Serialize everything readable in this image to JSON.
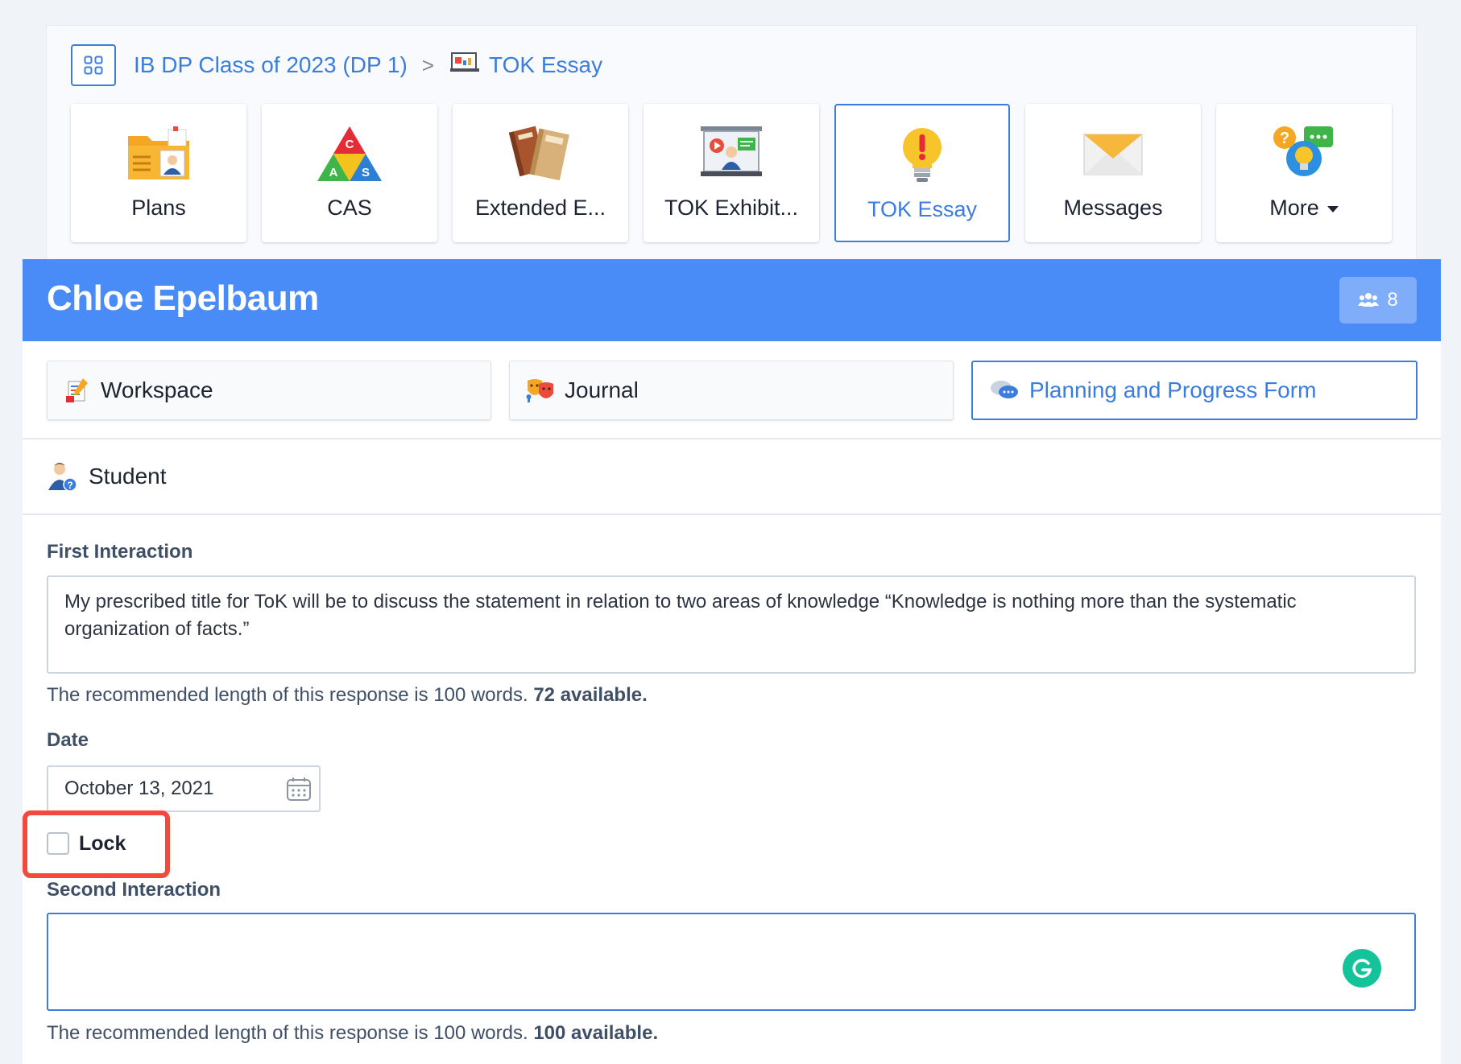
{
  "breadcrumb": {
    "class_name": "IB DP Class of 2023 (DP 1)",
    "separator": ">",
    "current": "TOK Essay"
  },
  "tiles": [
    {
      "label": "Plans",
      "icon": "folder-person-icon"
    },
    {
      "label": "CAS",
      "icon": "cas-triangle-icon"
    },
    {
      "label": "Extended E...",
      "icon": "books-icon"
    },
    {
      "label": "TOK Exhibit...",
      "icon": "presentation-icon"
    },
    {
      "label": "TOK Essay",
      "icon": "lightbulb-alert-icon",
      "active": true
    },
    {
      "label": "Messages",
      "icon": "envelope-icon"
    },
    {
      "label": "More",
      "icon": "question-chat-icon"
    }
  ],
  "banner": {
    "student_name": "Chloe Epelbaum",
    "group_count": "8",
    "color": "#4a8cf7"
  },
  "subtabs": {
    "workspace": "Workspace",
    "journal": "Journal",
    "planning": "Planning and Progress Form"
  },
  "section": {
    "title": "Student"
  },
  "form": {
    "first_label": "First Interaction",
    "first_value": "My prescribed title for ToK will be to discuss the statement in relation to two areas of knowledge “Knowledge is nothing more than the systematic organization of facts.”",
    "first_help": "The recommended length of this response is 100 words.",
    "first_available": "72 available.",
    "date_label": "Date",
    "date_value": "October 13, 2021",
    "lock_label": "Lock",
    "second_label": "Second Interaction",
    "second_value": "",
    "second_help": "The recommended length of this response is 100 words.",
    "second_available": "100 available."
  },
  "colors": {
    "accent": "#3b7ddd",
    "highlight_box": "#f24a3c"
  }
}
